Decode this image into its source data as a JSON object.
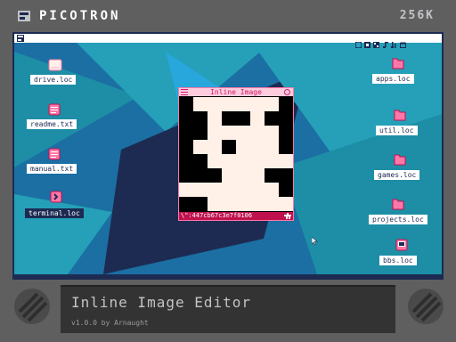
{
  "device": {
    "logo_text": "PICOTRON",
    "memory_text": "256K"
  },
  "menubar": {
    "tray_icons": [
      "code-icon",
      "sprite-icon",
      "map-icon",
      "music-icon",
      "sfx-icon",
      "window-icon"
    ]
  },
  "desktop": {
    "left_icons": [
      {
        "label": "drive.loc",
        "icon": "drive-icon"
      },
      {
        "label": "readme.txt",
        "icon": "document-icon"
      },
      {
        "label": "manual.txt",
        "icon": "document-icon"
      },
      {
        "label": "terminal.loc",
        "icon": "terminal-icon",
        "selected": true
      }
    ],
    "right_icons": [
      {
        "label": "apps.loc",
        "icon": "folder-icon"
      },
      {
        "label": "util.loc",
        "icon": "folder-icon"
      },
      {
        "label": "games.loc",
        "icon": "folder-icon"
      },
      {
        "label": "projects.loc",
        "icon": "folder-icon"
      },
      {
        "label": "bbs.loc",
        "icon": "bbs-icon"
      }
    ]
  },
  "window": {
    "title": "Inline Image",
    "status": "\\\":447cb67c3e7f0106",
    "pixels": [
      "10000001",
      "11011011",
      "11000001",
      "10010001",
      "11000000",
      "11100011",
      "00000001",
      "11000000"
    ],
    "colors": {
      "on": "#000000",
      "off": "#fff1e8"
    }
  },
  "info": {
    "app_title": "Inline Image Editor",
    "version": "v1.0.0 by Arnaught"
  },
  "colors": {
    "bezel": "#5f5f5f",
    "accent": "#ff77a8",
    "wallpaper_dark": "#1d2b53",
    "wallpaper_teal": "#29adff"
  }
}
